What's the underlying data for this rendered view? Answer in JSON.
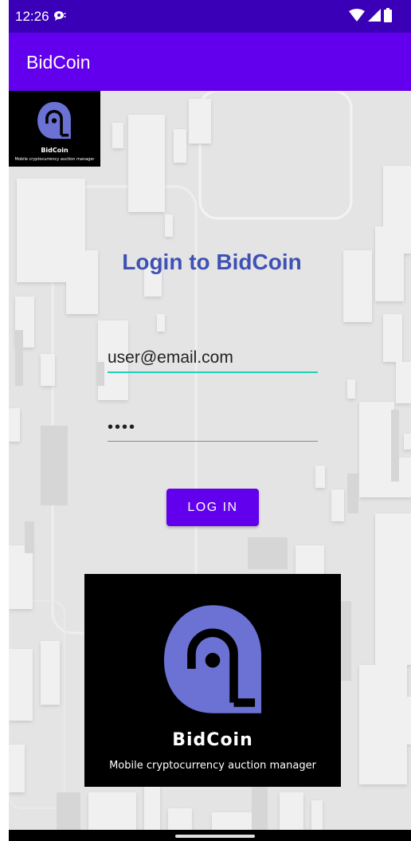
{
  "status_bar": {
    "time": "12:26",
    "icons": [
      "notification-icon",
      "wifi-icon",
      "signal-icon",
      "battery-icon"
    ]
  },
  "app_bar": {
    "title": "BidCoin"
  },
  "corner_logo": {
    "name": "BidCoin",
    "tagline": "Mobile cryptocurrency auction manager"
  },
  "login": {
    "heading": "Login to BidCoin",
    "email_value": "user@email.com",
    "password_value": "••••",
    "button_label": "LOG IN"
  },
  "big_logo": {
    "name": "BidCoin",
    "tagline": "Mobile cryptocurrency auction manager"
  },
  "colors": {
    "status_bar": "#3a00b8",
    "app_bar": "#6200ee",
    "heading": "#3f51b5",
    "accent_underline": "#1fd1b8",
    "logo_mark": "#6b72d4",
    "button": "#6200ee"
  }
}
